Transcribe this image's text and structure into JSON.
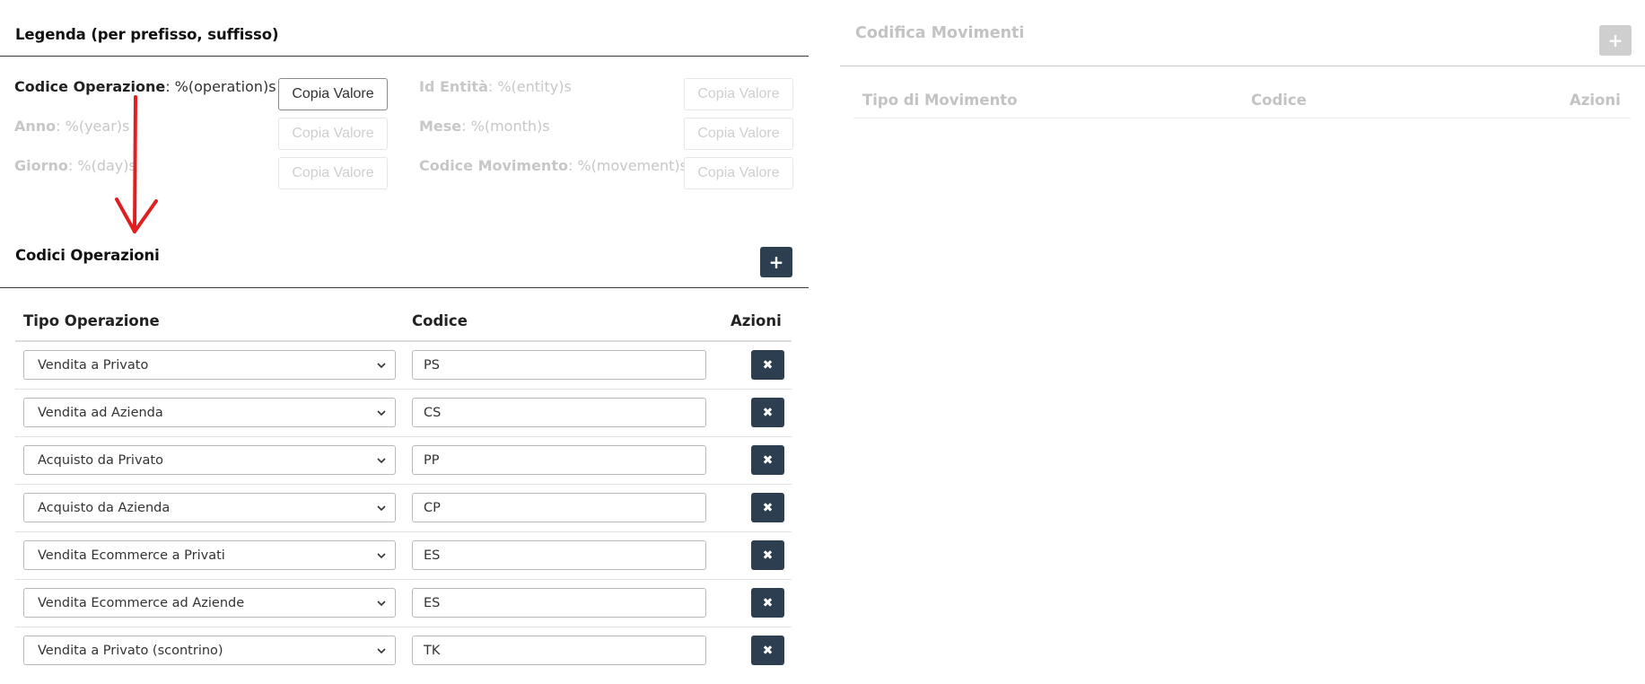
{
  "legend": {
    "title": "Legenda (per prefisso, suffisso)",
    "copy_label": "Copia Valore",
    "items": [
      {
        "key": "Codice Operazione",
        "value": ": %(operation)s"
      },
      {
        "key": "Id Entità",
        "value": ": %(entity)s"
      },
      {
        "key": "Anno",
        "value": ": %(year)s"
      },
      {
        "key": "Mese",
        "value": ": %(month)s"
      },
      {
        "key": "Giorno",
        "value": ": %(day)s"
      },
      {
        "key": "Codice Movimento",
        "value": ": %(movement)s"
      }
    ]
  },
  "operations": {
    "title": "Codici Operazioni",
    "add_icon": "plus-icon",
    "columns": {
      "type": "Tipo Operazione",
      "code": "Codice",
      "actions": "Azioni"
    },
    "rows": [
      {
        "type": "Vendita a Privato",
        "code": "PS"
      },
      {
        "type": "Vendita ad Azienda",
        "code": "CS"
      },
      {
        "type": "Acquisto da Privato",
        "code": "PP"
      },
      {
        "type": "Acquisto da Azienda",
        "code": "CP"
      },
      {
        "type": "Vendita Ecommerce a Privati",
        "code": "ES"
      },
      {
        "type": "Vendita Ecommerce ad Aziende",
        "code": "ES"
      },
      {
        "type": "Vendita a Privato (scontrino)",
        "code": "TK"
      }
    ],
    "delete_icon": "times-icon"
  },
  "movements": {
    "title": "Codifica Movimenti",
    "columns": {
      "type": "Tipo di Movimento",
      "code": "Codice",
      "actions": "Azioni"
    }
  },
  "colors": {
    "dark_button": "#2c3e50",
    "disabled_button": "#cfcfcf",
    "annotation_arrow": "#e02020",
    "muted_text": "#c7c7c7"
  }
}
